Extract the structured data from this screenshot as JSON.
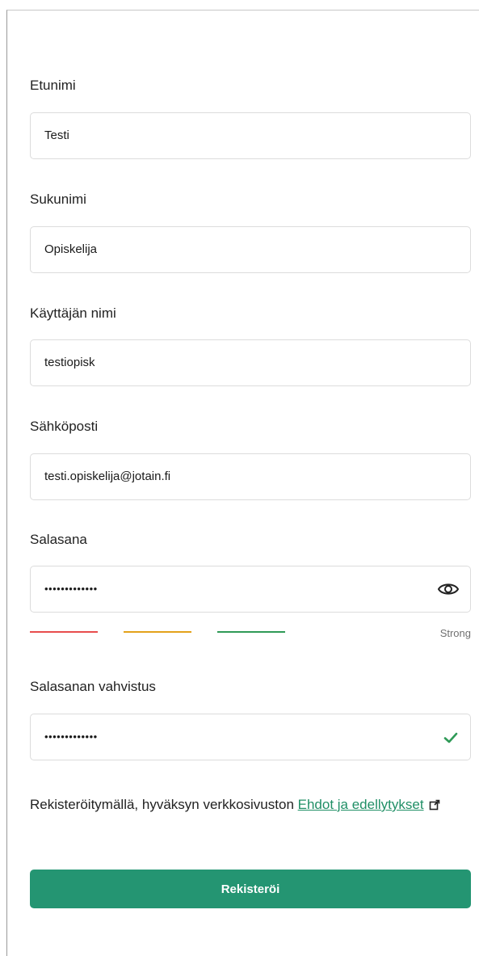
{
  "form": {
    "fields": [
      {
        "label": "Etunimi",
        "value": "Testi"
      },
      {
        "label": "Sukunimi",
        "value": "Opiskelija"
      },
      {
        "label": "Käyttäjän nimi",
        "value": "testiopisk"
      },
      {
        "label": "Sähköposti",
        "value": "testi.opiskelija@jotain.fi"
      }
    ],
    "password": {
      "label": "Salasana",
      "masked_value": "•••••••••••••",
      "strength_label": "Strong",
      "strength_colors": [
        "#e84d4d",
        "#e3a21a",
        "#2f9a57"
      ],
      "strength_level": "strong"
    },
    "confirm": {
      "label": "Salasanan vahvistus",
      "masked_value": "•••••••••••••",
      "check_color": "#2f9a57"
    },
    "terms": {
      "text": "Rekisteröitymällä, hyväksyn verkkosivuston ",
      "link": "Ehdot ja edellytykset",
      "link_icon": "external-link-icon"
    },
    "submit_label": "Rekisteröi",
    "accent_color": "#249572"
  }
}
